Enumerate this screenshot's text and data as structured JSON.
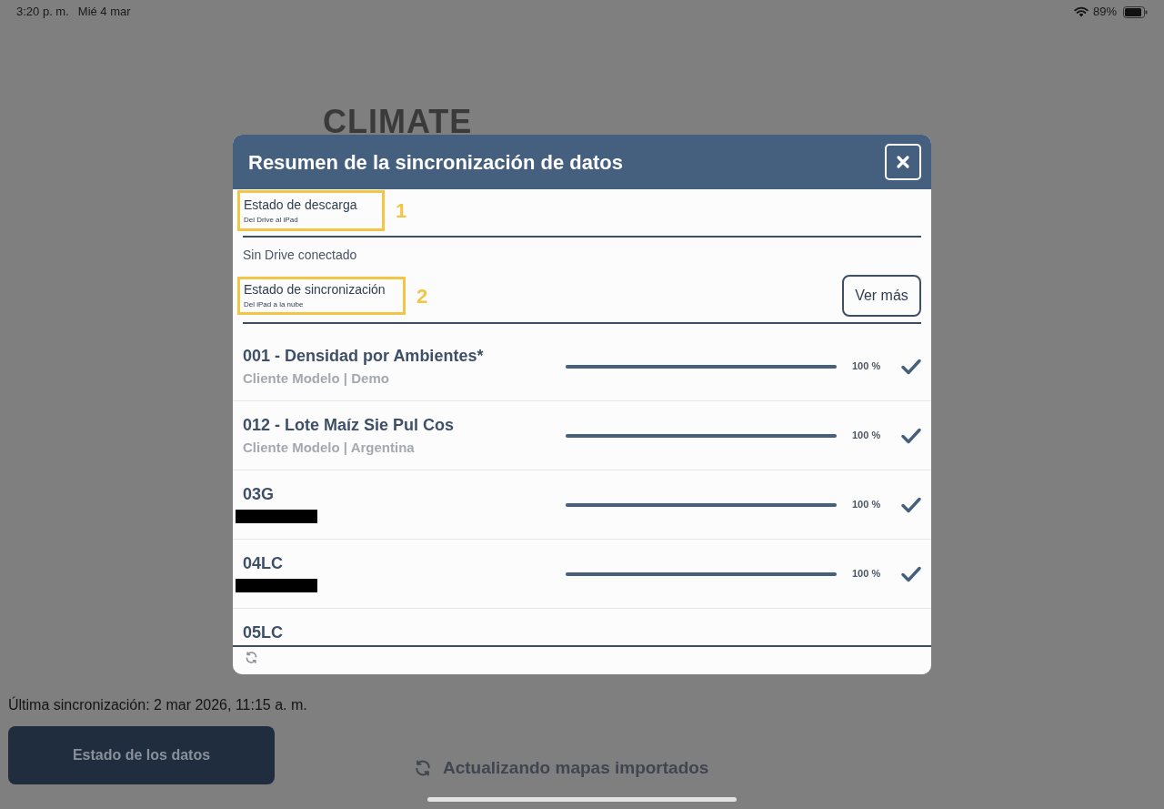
{
  "status_bar": {
    "time": "3:20 p. m.",
    "date": "Mié 4 mar",
    "battery": "89%"
  },
  "app": {
    "logo": "CLIMATE",
    "last_sync": "Última sincronización: 2 mar 2026, 11:15 a. m.",
    "data_button": "Estado de los datos",
    "activity": "Actualizando mapas importados"
  },
  "dialog": {
    "title": "Resumen de la sincronización de datos",
    "download_section": {
      "title": "Estado de descarga",
      "subtitle": "Del Drive al iPad",
      "annotation": "1",
      "status": "Sin Drive conectado"
    },
    "sync_section": {
      "title": "Estado de sincronización",
      "subtitle": "Del iPad a la nube",
      "annotation": "2",
      "button": "Ver más"
    },
    "items": [
      {
        "title": "001 - Densidad por Ambientes*",
        "subtitle": "Cliente Modelo | Demo",
        "redacted": false,
        "level": 1,
        "percent": "100 %",
        "done": true
      },
      {
        "title": "012 - Lote Maíz Sie Pul Cos",
        "subtitle": "Cliente Modelo | Argentina",
        "redacted": false,
        "level": 1,
        "percent": "100 %",
        "done": true
      },
      {
        "title": "03G",
        "redacted": true,
        "level": 1,
        "percent": "100 %",
        "done": true
      },
      {
        "title": "04LC",
        "redacted": true,
        "level": 1,
        "percent": "100 %",
        "done": true
      },
      {
        "title": "05LC"
      }
    ]
  }
}
